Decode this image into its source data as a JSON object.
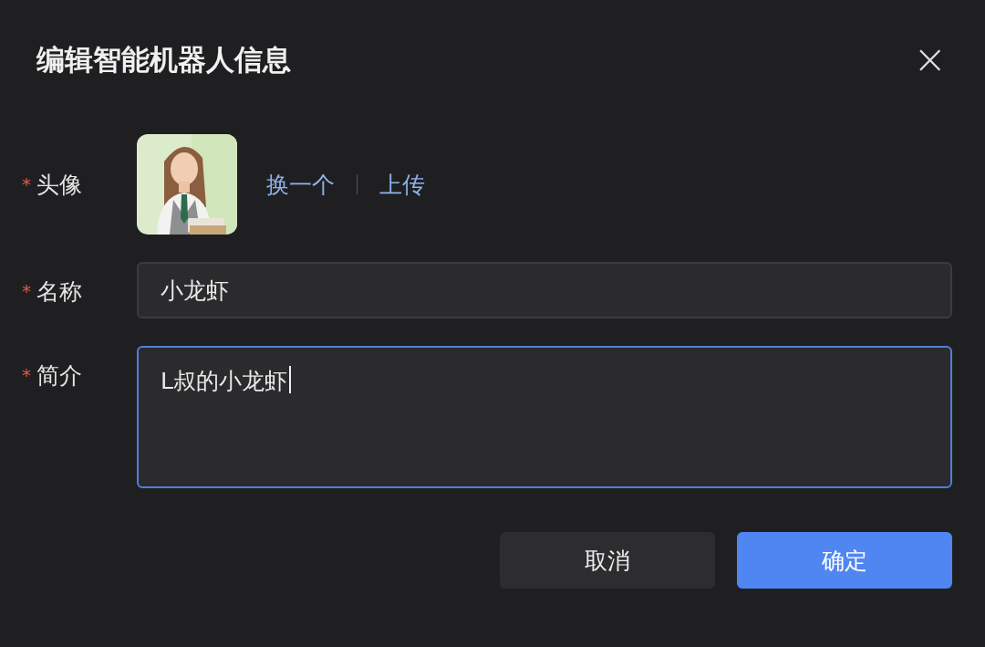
{
  "dialog": {
    "title": "编辑智能机器人信息",
    "close_icon": "×"
  },
  "avatar_row": {
    "label": "头像",
    "required_mark": "*",
    "actions": [
      "换一个",
      "上传"
    ]
  },
  "name_row": {
    "label": "名称",
    "required_mark": "*",
    "value": "小龙虾",
    "focused": false
  },
  "intro_row": {
    "label": "简介",
    "required_mark": "*",
    "value": "L叔的小龙虾",
    "focused": true
  },
  "buttons": [
    {
      "label": "取消",
      "kind": "secondary"
    },
    {
      "label": "确定",
      "kind": "primary"
    }
  ]
}
